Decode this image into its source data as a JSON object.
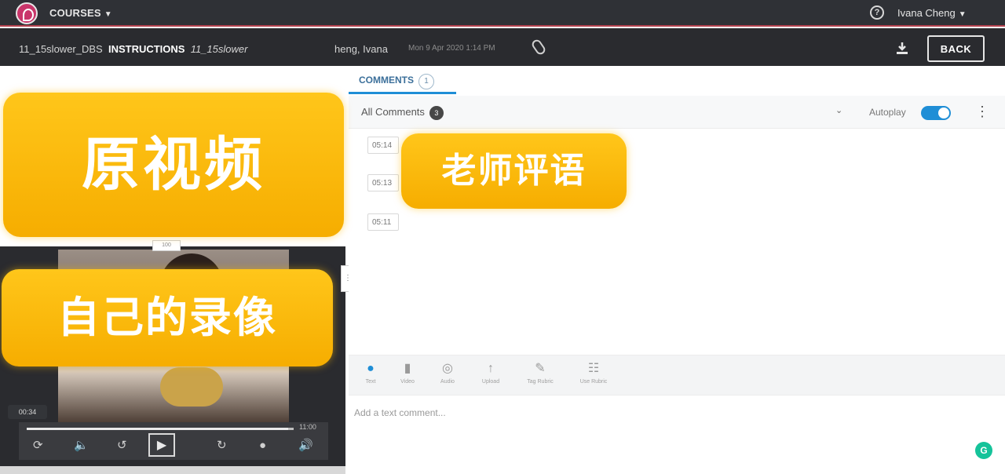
{
  "app": {
    "courses_label": "COURSES",
    "help_icon": "help-circle-icon",
    "user_name": "Ivana Cheng",
    "accent_color": "#1f8ed6",
    "brand_color": "#c9356a"
  },
  "subheader": {
    "assignment": "11_15slower_DBS",
    "section": "INSTRUCTIONS",
    "item": "11_15slower",
    "student": "heng, Ivana",
    "date": "Mon 9 Apr 2020 1:14 PM",
    "back_label": "BACK"
  },
  "video": {
    "current_time": "00:34",
    "duration": "11:00",
    "progress": 0.98,
    "handle_text": "100"
  },
  "overlays": {
    "original_video": "原视频",
    "own_recording": "自己的录像",
    "teacher_comments": "老师评语"
  },
  "comments": {
    "tab_label": "COMMENTS",
    "tab_count": "1",
    "filter_label": "All Comments",
    "filter_count": "3",
    "autoplay_label": "Autoplay",
    "autoplay_on": true,
    "timestamps": [
      "05:14",
      "05:13",
      "05:11"
    ]
  },
  "composer": {
    "tools": [
      {
        "label": "Text",
        "icon": "speech-bubble-icon"
      },
      {
        "label": "Video",
        "icon": "video-camera-icon"
      },
      {
        "label": "Audio",
        "icon": "microphone-icon"
      },
      {
        "label": "Upload",
        "icon": "upload-icon"
      },
      {
        "label": "Tag Rubric",
        "icon": "edit-icon"
      },
      {
        "label": "Use Rubric",
        "icon": "rubric-icon"
      }
    ],
    "placeholder": "Add a text comment..."
  }
}
